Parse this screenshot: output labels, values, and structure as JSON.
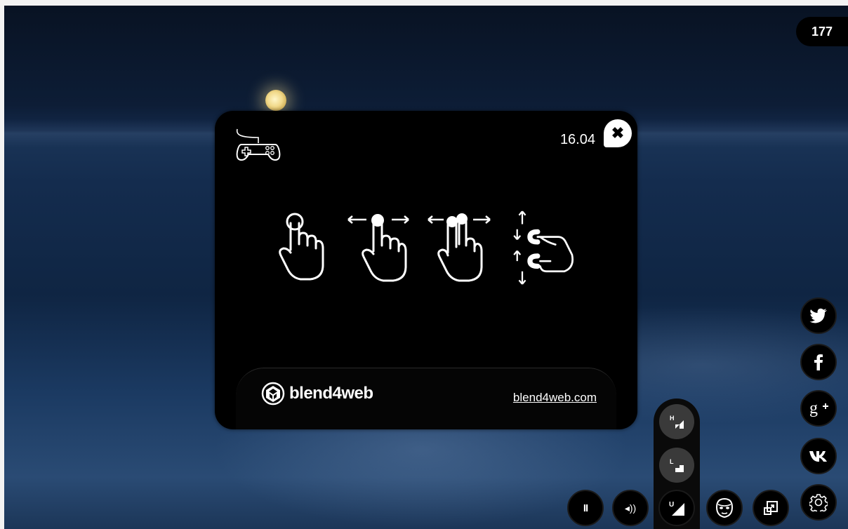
{
  "fps_counter": "177",
  "dialog": {
    "version": "16.04",
    "close_glyph": "✖",
    "brand_name": "blend4web",
    "site_link": "blend4web.com",
    "gestures": [
      "single-tap-gesture",
      "one-finger-swipe-gesture",
      "two-finger-swipe-gesture",
      "pinch-zoom-gesture"
    ]
  },
  "social_buttons": [
    "twitter-icon",
    "facebook-icon",
    "google-plus-icon",
    "vk-icon",
    "settings-icon"
  ],
  "bottom_toolbar": {
    "pause_glyph": "II",
    "sound_glyph": "◂))",
    "quality_current": "U",
    "quality_options": [
      "H",
      "L"
    ]
  },
  "colors": {
    "panel": "#000000",
    "accent": "#ffffff",
    "button_bg": "#000000",
    "quality_option_bg": "#3a3a3a"
  }
}
